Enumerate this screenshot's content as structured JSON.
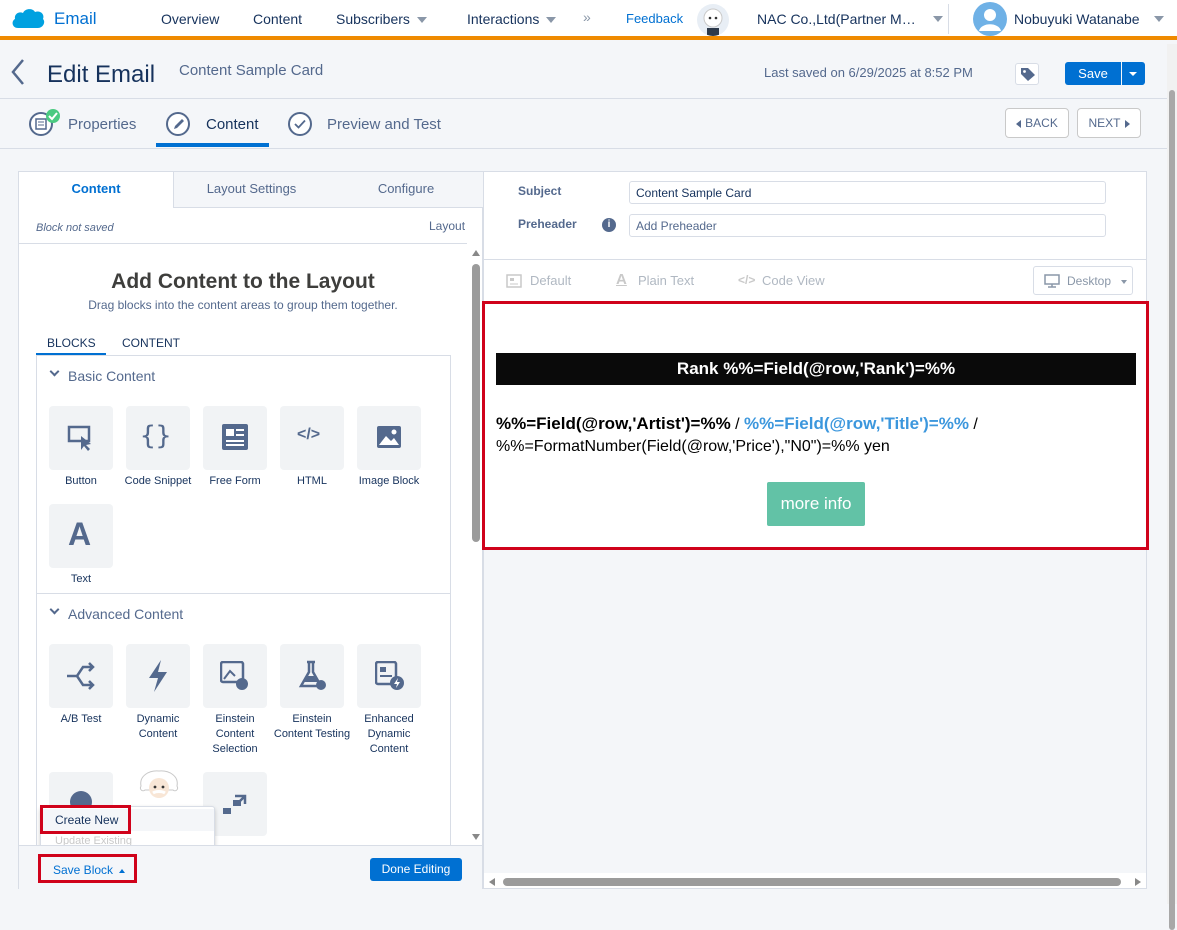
{
  "topnav": {
    "app_name": "Email",
    "items": [
      "Overview",
      "Content",
      "Subscribers",
      "Interactions",
      "Feedback"
    ],
    "more": "»",
    "account": "NAC Co.,Ltd(Partner M…",
    "user": "Nobuyuki Watanabe"
  },
  "header": {
    "title": "Edit Email",
    "subtitle": "Content Sample Card",
    "last_saved": "Last saved on 6/29/2025 at 8:52 PM",
    "save": "Save"
  },
  "steps": {
    "items": [
      "Properties",
      "Content",
      "Preview and Test"
    ],
    "back": "BACK",
    "next": "NEXT"
  },
  "left": {
    "tabs": [
      "Content",
      "Layout Settings",
      "Configure"
    ],
    "block_status": "Block not saved",
    "layout_label": "Layout",
    "heading": "Add Content to the Layout",
    "subheading": "Drag blocks into the content areas to group them together.",
    "subtabs": [
      "BLOCKS",
      "CONTENT"
    ],
    "basic_title": "Basic Content",
    "basic_blocks": [
      "Button",
      "Code Snippet",
      "Free Form",
      "HTML",
      "Image Block",
      "Text"
    ],
    "advanced_title": "Advanced Content",
    "advanced_blocks": [
      "A/B Test",
      "Dynamic Content",
      "Einstein Content Selection",
      "Einstein Content Testing",
      "Enhanced Dynamic Content"
    ],
    "popup": {
      "create_new": "Create New",
      "update_existing": "Update Existing"
    },
    "save_block": "Save Block",
    "done_editing": "Done Editing"
  },
  "right": {
    "subject_label": "Subject",
    "subject_value": "Content Sample Card",
    "preheader_label": "Preheader",
    "preheader_placeholder": "Add Preheader",
    "views": [
      "Default",
      "Plain Text",
      "Code View"
    ],
    "device": "Desktop",
    "rank_bar": "Rank %%=Field(@row,'Rank')=%%",
    "artist": "%%=Field(@row,'Artist')=%%",
    "sep1": " / ",
    "title_field": "%%=Field(@row,'Title')=%%",
    "sep2": " /",
    "price": "%%=FormatNumber(Field(@row,'Price'),\"N0\")=%% yen",
    "button": "more info"
  },
  "colors": {
    "accent": "#0070d2",
    "orange_bar": "#ef8a00",
    "highlight": "#d0021b",
    "teal_button": "#62c2a6",
    "link_blue": "#3c97dd"
  }
}
